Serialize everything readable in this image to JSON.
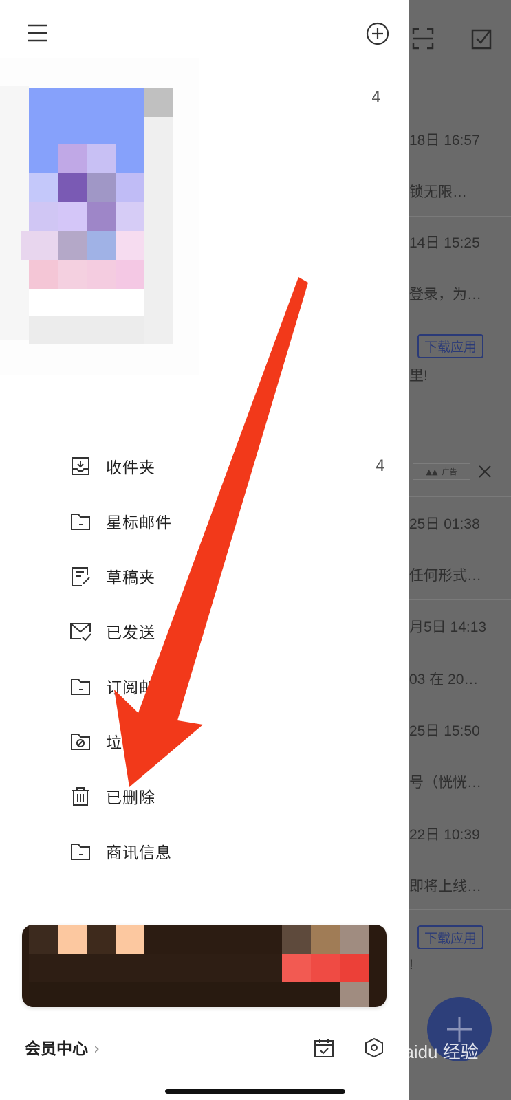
{
  "background": {
    "dates": [
      "18日 16:57",
      "14日 15:25",
      "25日 01:38",
      "月5日 14:13",
      "25日 15:50",
      "22日 10:39"
    ],
    "snippets": [
      "锁无限…",
      "登录，为…",
      "任何形式…",
      "03 在 20…",
      "号（恍恍…",
      "即将上线…"
    ],
    "download_label": "下载应用",
    "fragment_1": "里!",
    "fragment_2": "!",
    "ad_label": "广告",
    "compose_icon": "plus-icon"
  },
  "drawer": {
    "account_count": "4",
    "menu": [
      {
        "label": "收件夹",
        "count": "4",
        "icon": "inbox-icon"
      },
      {
        "label": "星标邮件",
        "count": "",
        "icon": "folder-icon"
      },
      {
        "label": "草稿夹",
        "count": "",
        "icon": "draft-icon"
      },
      {
        "label": "已发送",
        "count": "",
        "icon": "sent-mail-icon"
      },
      {
        "label": "订阅邮",
        "count": "",
        "icon": "folder-icon"
      },
      {
        "label": "垃",
        "count": "",
        "icon": "spam-folder-icon"
      },
      {
        "label": "已删除",
        "count": "",
        "icon": "trash-icon"
      },
      {
        "label": "商讯信息",
        "count": "",
        "icon": "folder-icon"
      }
    ],
    "footer": {
      "member_center": "会员中心",
      "chevron": "›"
    }
  },
  "watermark": "Baidu 经验",
  "colors": {
    "arrow": "#f2391a",
    "accent": "#2d3f7a"
  }
}
